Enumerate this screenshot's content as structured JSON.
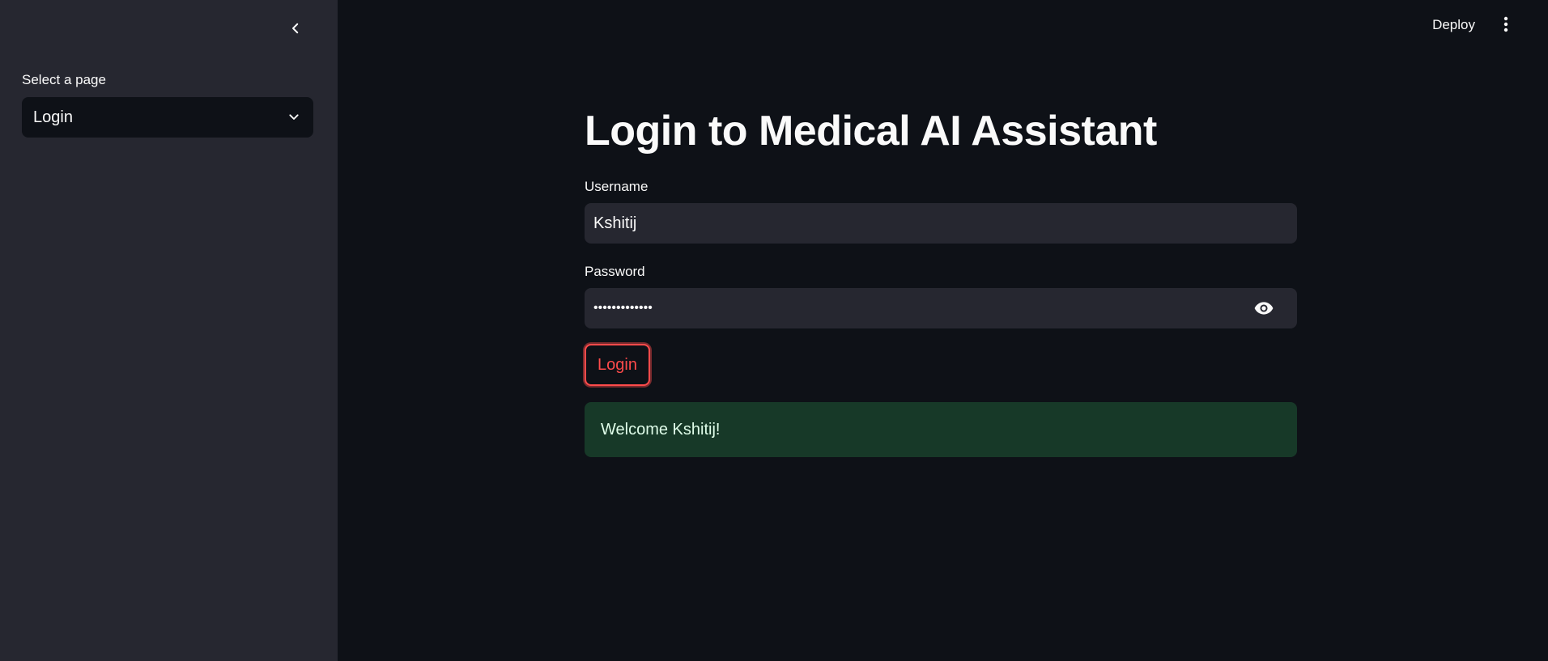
{
  "sidebar": {
    "collapse_icon": "chevron-left-icon",
    "select_label": "Select a page",
    "select_value": "Login",
    "select_icon": "chevron-down-icon"
  },
  "header": {
    "deploy_label": "Deploy",
    "menu_icon": "vertical-dots-icon"
  },
  "main": {
    "title": "Login to Medical AI Assistant",
    "username": {
      "label": "Username",
      "value": "Kshitij"
    },
    "password": {
      "label": "Password",
      "value": "•••••••••••••",
      "toggle_icon": "eye-icon"
    },
    "login_button": "Login",
    "success_message": "Welcome Kshitij!"
  },
  "colors": {
    "background": "#0e1117",
    "sidebar": "#262730",
    "input_bg": "#262730",
    "accent": "#ff4b4b",
    "success_bg": "#173928",
    "success_text": "#dffde9"
  }
}
